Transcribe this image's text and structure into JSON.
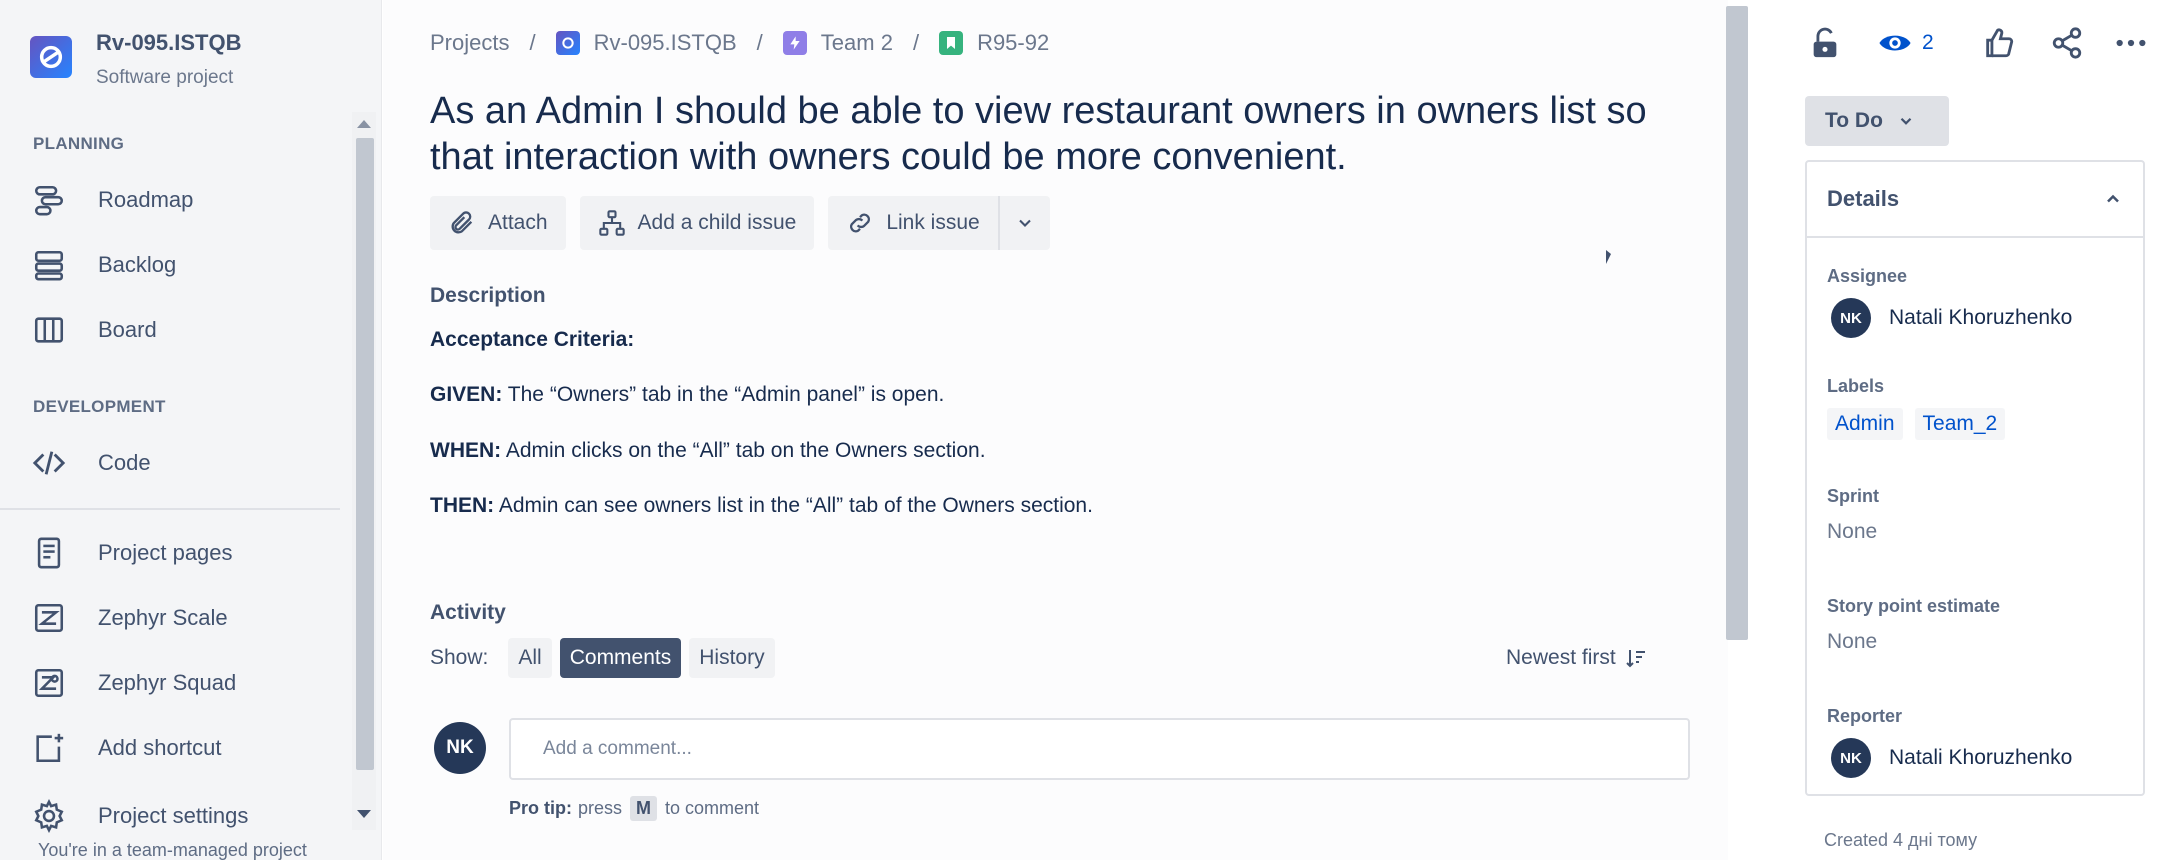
{
  "sidebar": {
    "project_name": "Rv-095.ISTQB",
    "project_type": "Software project",
    "planning_label": "PLANNING",
    "development_label": "DEVELOPMENT",
    "items": [
      {
        "label": "Roadmap",
        "icon": "roadmap-icon"
      },
      {
        "label": "Backlog",
        "icon": "backlog-icon"
      },
      {
        "label": "Board",
        "icon": "board-icon"
      },
      {
        "label": "Code",
        "icon": "code-icon"
      },
      {
        "label": "Project pages",
        "icon": "pages-icon"
      },
      {
        "label": "Zephyr Scale",
        "icon": "zephyr-scale-icon"
      },
      {
        "label": "Zephyr Squad",
        "icon": "zephyr-squad-icon"
      },
      {
        "label": "Add shortcut",
        "icon": "add-shortcut-icon"
      },
      {
        "label": "Project settings",
        "icon": "gear-icon"
      }
    ],
    "team_note": "You're in a team-managed project"
  },
  "breadcrumb": {
    "projects": "Projects",
    "project": "Rv-095.ISTQB",
    "team": "Team 2",
    "issue": "R95-92",
    "separator": "/"
  },
  "issue": {
    "title": "As an Admin I should be able to view restaurant owners in owners list so that interaction with owners could be more convenient."
  },
  "toolbar": {
    "attach": "Attach",
    "add_child": "Add a child issue",
    "link_issue": "Link issue"
  },
  "description": {
    "heading": "Description",
    "criteria": "Acceptance Criteria:",
    "given_key": "GIVEN:",
    "given_text": " The “Owners” tab in the “Admin panel” is open.",
    "when_key": "WHEN:",
    "when_text": " Admin clicks on the “All” tab on the Owners section.",
    "then_key": "THEN:",
    "then_text": " Admin can see owners list in the “All” tab of the Owners section."
  },
  "activity": {
    "heading": "Activity",
    "show_label": "Show:",
    "tabs": [
      "All",
      "Comments",
      "History"
    ],
    "active_tab": "Comments",
    "sort_label": "Newest first",
    "comment_placeholder": "Add a comment...",
    "avatar_initials": "NK",
    "pro_tip_label": "Pro tip:",
    "pro_tip_pre": "press",
    "pro_tip_key": "M",
    "pro_tip_post": "to comment"
  },
  "right_panel": {
    "watchers_count": "2",
    "status": "To Do",
    "details_heading": "Details",
    "assignee_label": "Assignee",
    "assignee_name": "Natali Khoruzhenko",
    "assignee_initials": "NK",
    "labels_label": "Labels",
    "labels": [
      "Admin",
      "Team_2"
    ],
    "sprint_label": "Sprint",
    "sprint_value": "None",
    "story_points_label": "Story point estimate",
    "story_points_value": "None",
    "reporter_label": "Reporter",
    "reporter_name": "Natali Khoruzhenko",
    "reporter_initials": "NK",
    "created": "Created 4 дні тому"
  },
  "colors": {
    "accent": "#0052cc",
    "active_tab_bg": "#42526e",
    "avatar_bg": "#253858"
  }
}
